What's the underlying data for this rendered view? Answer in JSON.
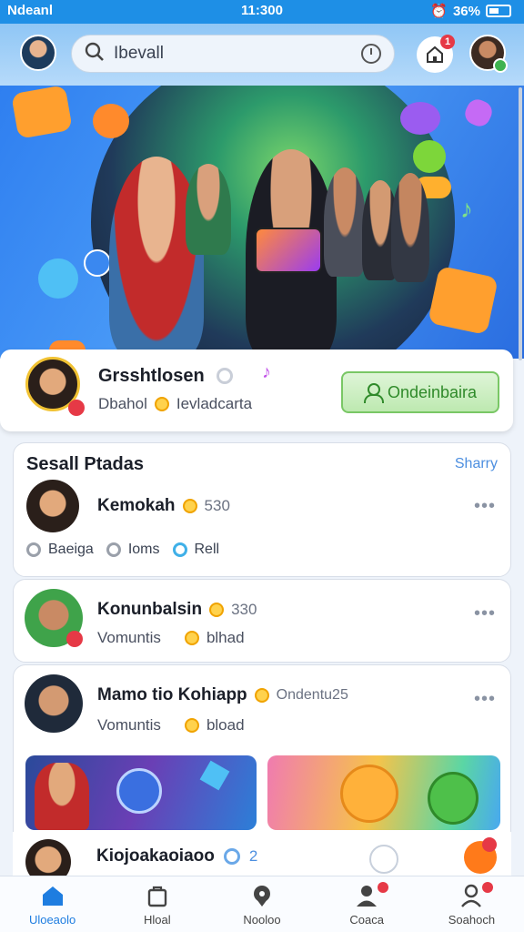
{
  "status_bar": {
    "carrier": "Ndeanl",
    "time": "11:300",
    "battery": "36%"
  },
  "header": {
    "search_value": "Ibevall",
    "notification_count": "1"
  },
  "profile": {
    "name": "Grsshtlosen",
    "handle": "Dbahol",
    "subtitle": "Ievladcarta",
    "follow_label": "Ondeinbaira"
  },
  "social": {
    "title": "Sesall Ptadas",
    "link": "Sharry",
    "posts": [
      {
        "name": "Kemokah",
        "count": "530",
        "tags": [
          "Baeiga",
          "Ioms",
          "Rell"
        ]
      },
      {
        "name": "Konunbalsin",
        "count": "330",
        "sub": "Vomuntis",
        "sub2": "blhad"
      },
      {
        "name": "Mamo tio Kohiapp",
        "extra": "Ondentu25",
        "sub": "Vomuntis",
        "sub2": "bload"
      }
    ],
    "last_post": {
      "name": "Kiojoakaoiaoo",
      "count": "2"
    }
  },
  "nav": {
    "items": [
      "Uloeaolo",
      "Hloal",
      "Nooloo",
      "Coaca",
      "Soahoch"
    ]
  },
  "colors": {
    "accent": "#1e8fe6",
    "follow_green": "#79c765",
    "badge": "#e63946"
  }
}
